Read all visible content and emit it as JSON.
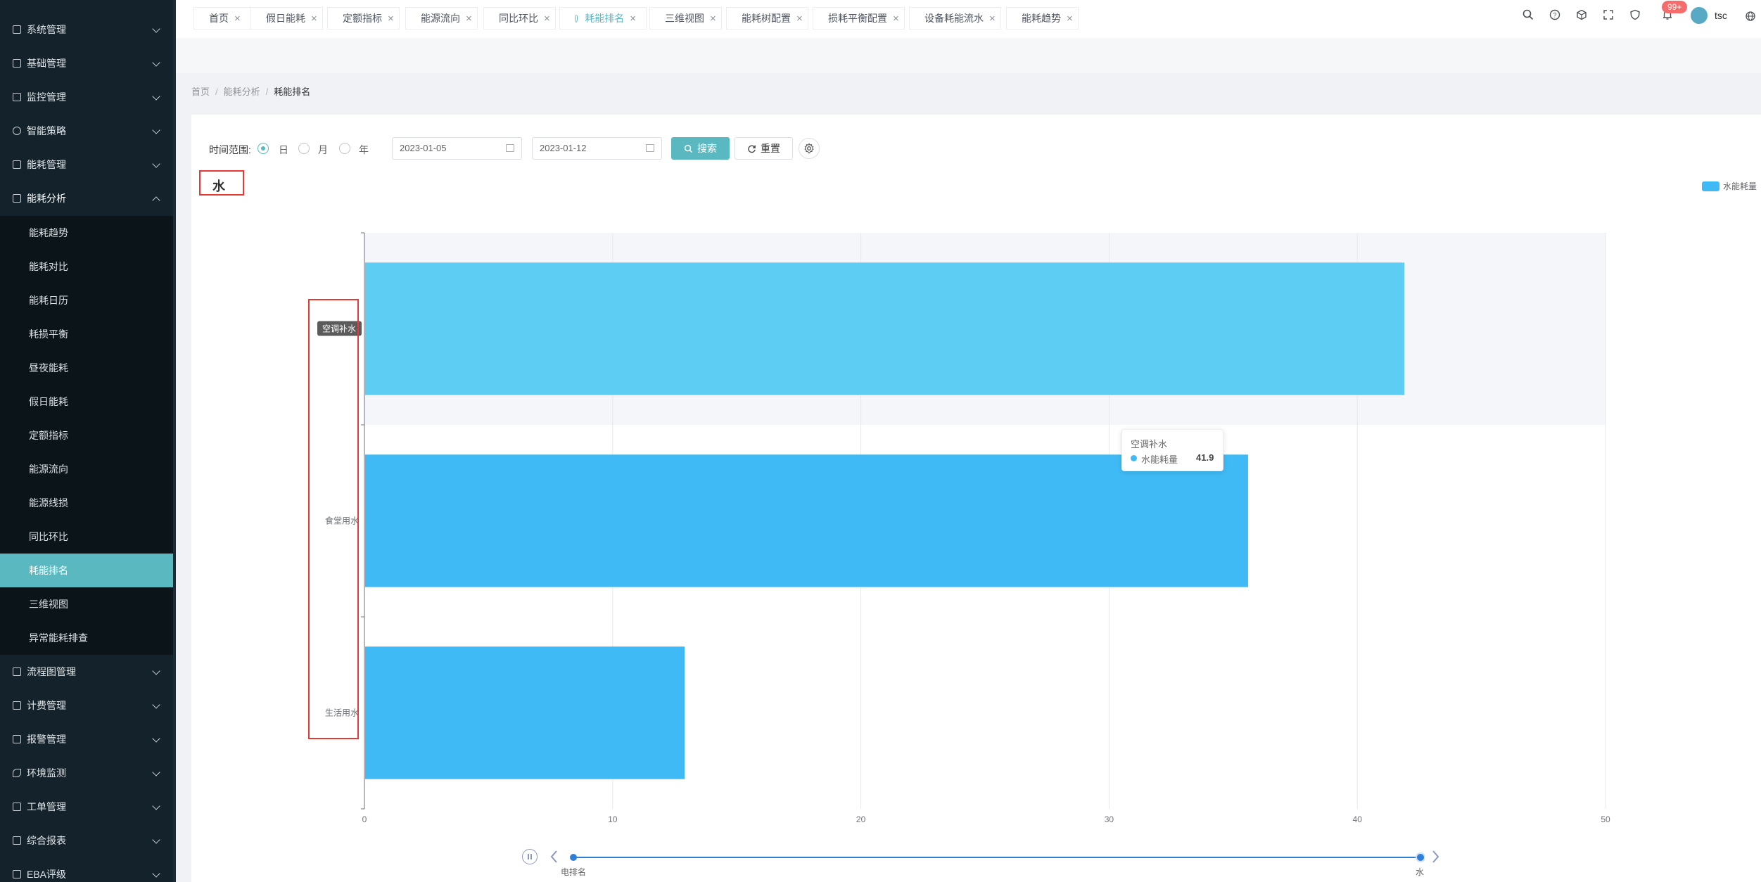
{
  "sidebar": {
    "menu_top": [
      {
        "label": "系统管理"
      },
      {
        "label": "基础管理"
      },
      {
        "label": "监控管理"
      },
      {
        "label": "智能策略"
      },
      {
        "label": "能耗管理"
      },
      {
        "label": "能耗分析"
      }
    ],
    "submenu": [
      {
        "label": "能耗趋势"
      },
      {
        "label": "能耗对比"
      },
      {
        "label": "能耗日历"
      },
      {
        "label": "耗损平衡"
      },
      {
        "label": "昼夜能耗"
      },
      {
        "label": "假日能耗"
      },
      {
        "label": "定额指标"
      },
      {
        "label": "能源流向"
      },
      {
        "label": "能源线损"
      },
      {
        "label": "同比环比"
      },
      {
        "label": "耗能排名"
      },
      {
        "label": "三维视图"
      },
      {
        "label": "异常能耗排查"
      }
    ],
    "menu_bottom": [
      {
        "label": "流程图管理"
      },
      {
        "label": "计费管理"
      },
      {
        "label": "报警管理"
      },
      {
        "label": "环境监测"
      },
      {
        "label": "工单管理"
      },
      {
        "label": "综合报表"
      },
      {
        "label": "EBA评级"
      }
    ]
  },
  "header": {
    "notification_badge": "99+",
    "username": "tsc"
  },
  "tabs": [
    {
      "label": "首页"
    },
    {
      "label": "假日能耗"
    },
    {
      "label": "定额指标"
    },
    {
      "label": "能源流向"
    },
    {
      "label": "同比环比"
    },
    {
      "label": "耗能排名"
    },
    {
      "label": "三维视图"
    },
    {
      "label": "能耗树配置"
    },
    {
      "label": "损耗平衡配置"
    },
    {
      "label": "设备耗能流水"
    },
    {
      "label": "能耗趋势"
    }
  ],
  "breadcrumb": [
    "首页",
    "能耗分析",
    "耗能排名"
  ],
  "filter": {
    "time_range_label": "时间范围:",
    "options": [
      "日",
      "月",
      "年"
    ],
    "selected": "日",
    "start_date": "2023-01-05",
    "end_date": "2023-01-12",
    "search_label": "搜索",
    "reset_label": "重置"
  },
  "chart_title": "水",
  "chart_data": {
    "type": "bar",
    "orientation": "horizontal",
    "categories": [
      "空调补水",
      "食堂用水",
      "生活用水"
    ],
    "series": [
      {
        "name": "水能耗量",
        "values": [
          41.9,
          35.6,
          12.9
        ]
      }
    ],
    "xticks": [
      "0",
      "10",
      "20",
      "30",
      "40",
      "50"
    ],
    "xlim": [
      0,
      50
    ],
    "legend_position": "top-right",
    "grid": true
  },
  "tooltip": {
    "category": "空调补水",
    "series": "水能耗量",
    "value": "41.9"
  },
  "timeline": {
    "start_label": "电排名",
    "end_label": "水"
  },
  "colors": {
    "accent": "#5ab8c0",
    "bar_highlight": "#5dcdf4",
    "bar": "#40baf5",
    "sidebar_bg": "#14232b",
    "annotation_red": "#e53935"
  }
}
